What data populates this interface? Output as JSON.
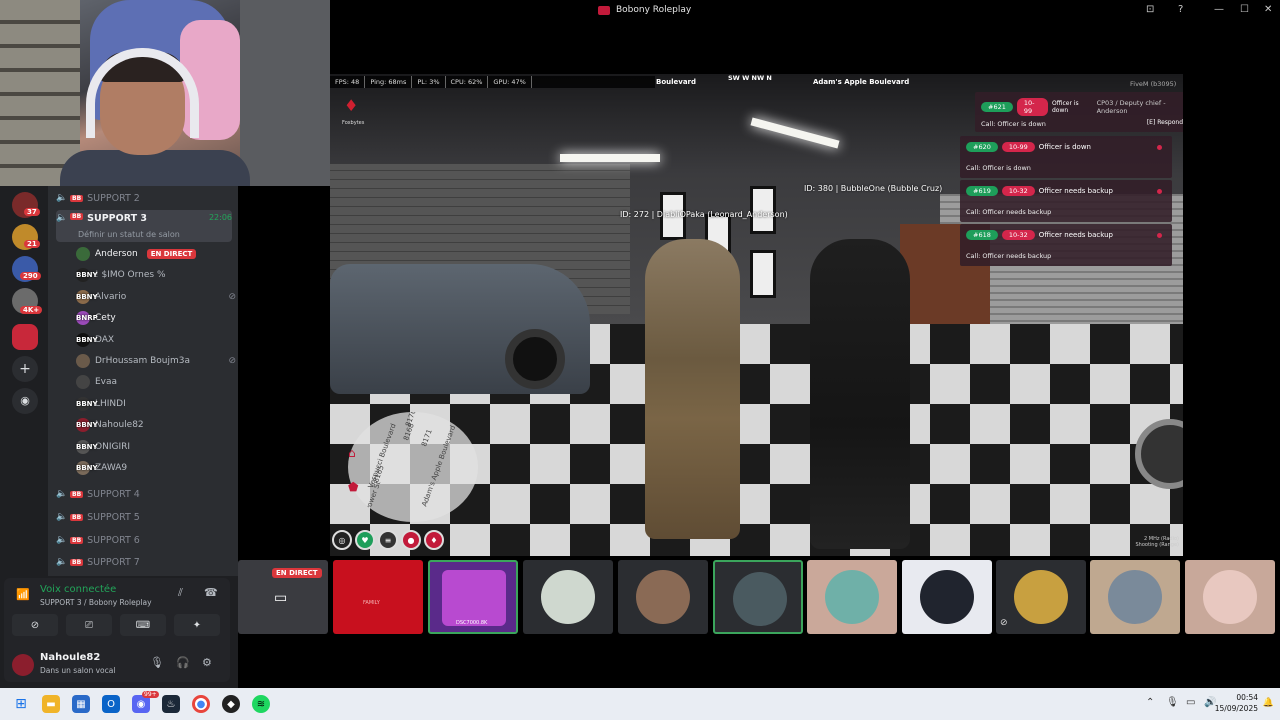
{
  "window": {
    "title": "Bobony Roleplay",
    "controls": [
      "⊡",
      "?",
      "—",
      "☐",
      "✕"
    ]
  },
  "discord": {
    "servers": [
      {
        "badge": "37"
      },
      {
        "badge": "21"
      },
      {
        "badge": "290"
      },
      {
        "badge": "4K+"
      }
    ],
    "channels_top": [
      {
        "label": "SUPPORT 2",
        "prefix": "BB"
      }
    ],
    "active_channel": {
      "label": "SUPPORT 3",
      "prefix": "BB",
      "time": "22:06",
      "status": "Définir un statut de salon"
    },
    "users": [
      {
        "name": "Anderson",
        "live": "EN DIRECT",
        "tag": ""
      },
      {
        "name": "! $IMO Ornes %",
        "tag": "BBNY"
      },
      {
        "name": "Alvario",
        "tag": "BBNY",
        "muted": true
      },
      {
        "name": "Cety",
        "tag": "BNRP"
      },
      {
        "name": "DAX",
        "tag": "BBNY"
      },
      {
        "name": "DrHoussam Boujm3a",
        "tag": "",
        "muted": true
      },
      {
        "name": "Evaa",
        "tag": ""
      },
      {
        "name": "LHINDI",
        "tag": "BBNY"
      },
      {
        "name": "Nahoule82",
        "tag": "BBNY"
      },
      {
        "name": "ONIGIRI",
        "tag": "BBNY"
      },
      {
        "name": "ZAWA9",
        "tag": "BBNY"
      }
    ],
    "channels_bottom": [
      {
        "label": "SUPPORT 4"
      },
      {
        "label": "SUPPORT 5"
      },
      {
        "label": "SUPPORT 6"
      },
      {
        "label": "SUPPORT 7"
      }
    ],
    "voice": {
      "title": "Voix connectée",
      "sub": "SUPPORT 3 / Bobony Roleplay"
    },
    "me": {
      "name": "Nahoule82",
      "status": "Dans un salon vocal"
    }
  },
  "game": {
    "hud": [
      "FPS: 48",
      "Ping: 68ms",
      "PL: 3%",
      "CPU: 62%",
      "GPU: 47%"
    ],
    "street_left": "Boulevard",
    "street_right": "Adam's Apple Boulevard",
    "compass": "SW  W  NW  N",
    "fivem": "FiveM (b3095)",
    "logo_text": "Foxbytes",
    "tag1": "ID: 272 | DiabliOPaka (Leonard_Anderson)",
    "tag2": "ID: 380 | BubbleOne (Bubble Cruz)",
    "dispatch": [
      {
        "id": "#621",
        "code": "10-99",
        "title": "CP03 / Deputy chief -Anderson",
        "overlay": "Officer is down",
        "call": "Call: Officer is down",
        "respond": "[E] Respond"
      },
      {
        "id": "#620",
        "code": "10-99",
        "title": "Officer is down",
        "call": "Call: Officer is down"
      },
      {
        "id": "#619",
        "code": "10-32",
        "title": "Officer needs backup",
        "call": "Call: Officer needs backup"
      },
      {
        "id": "#618",
        "code": "10-32",
        "title": "Officer needs backup",
        "call": "Call: Officer needs backup"
      }
    ],
    "map_labels": [
      "Adam's Apple Boulevard",
      "Vespucci Boulevard",
      "8168",
      "8171",
      "8170",
      "8165",
      "Power St"
    ],
    "radio": [
      "2 MHz (Radio)",
      "Shooting (Range)"
    ]
  },
  "strip": {
    "live": "EN DIRECT",
    "tile2_text": "FAMILY",
    "tile3_text": "DSC7000.8K"
  },
  "taskbar": {
    "time": "00:54",
    "date": "15/09/2025",
    "discord_badge": "99+"
  }
}
